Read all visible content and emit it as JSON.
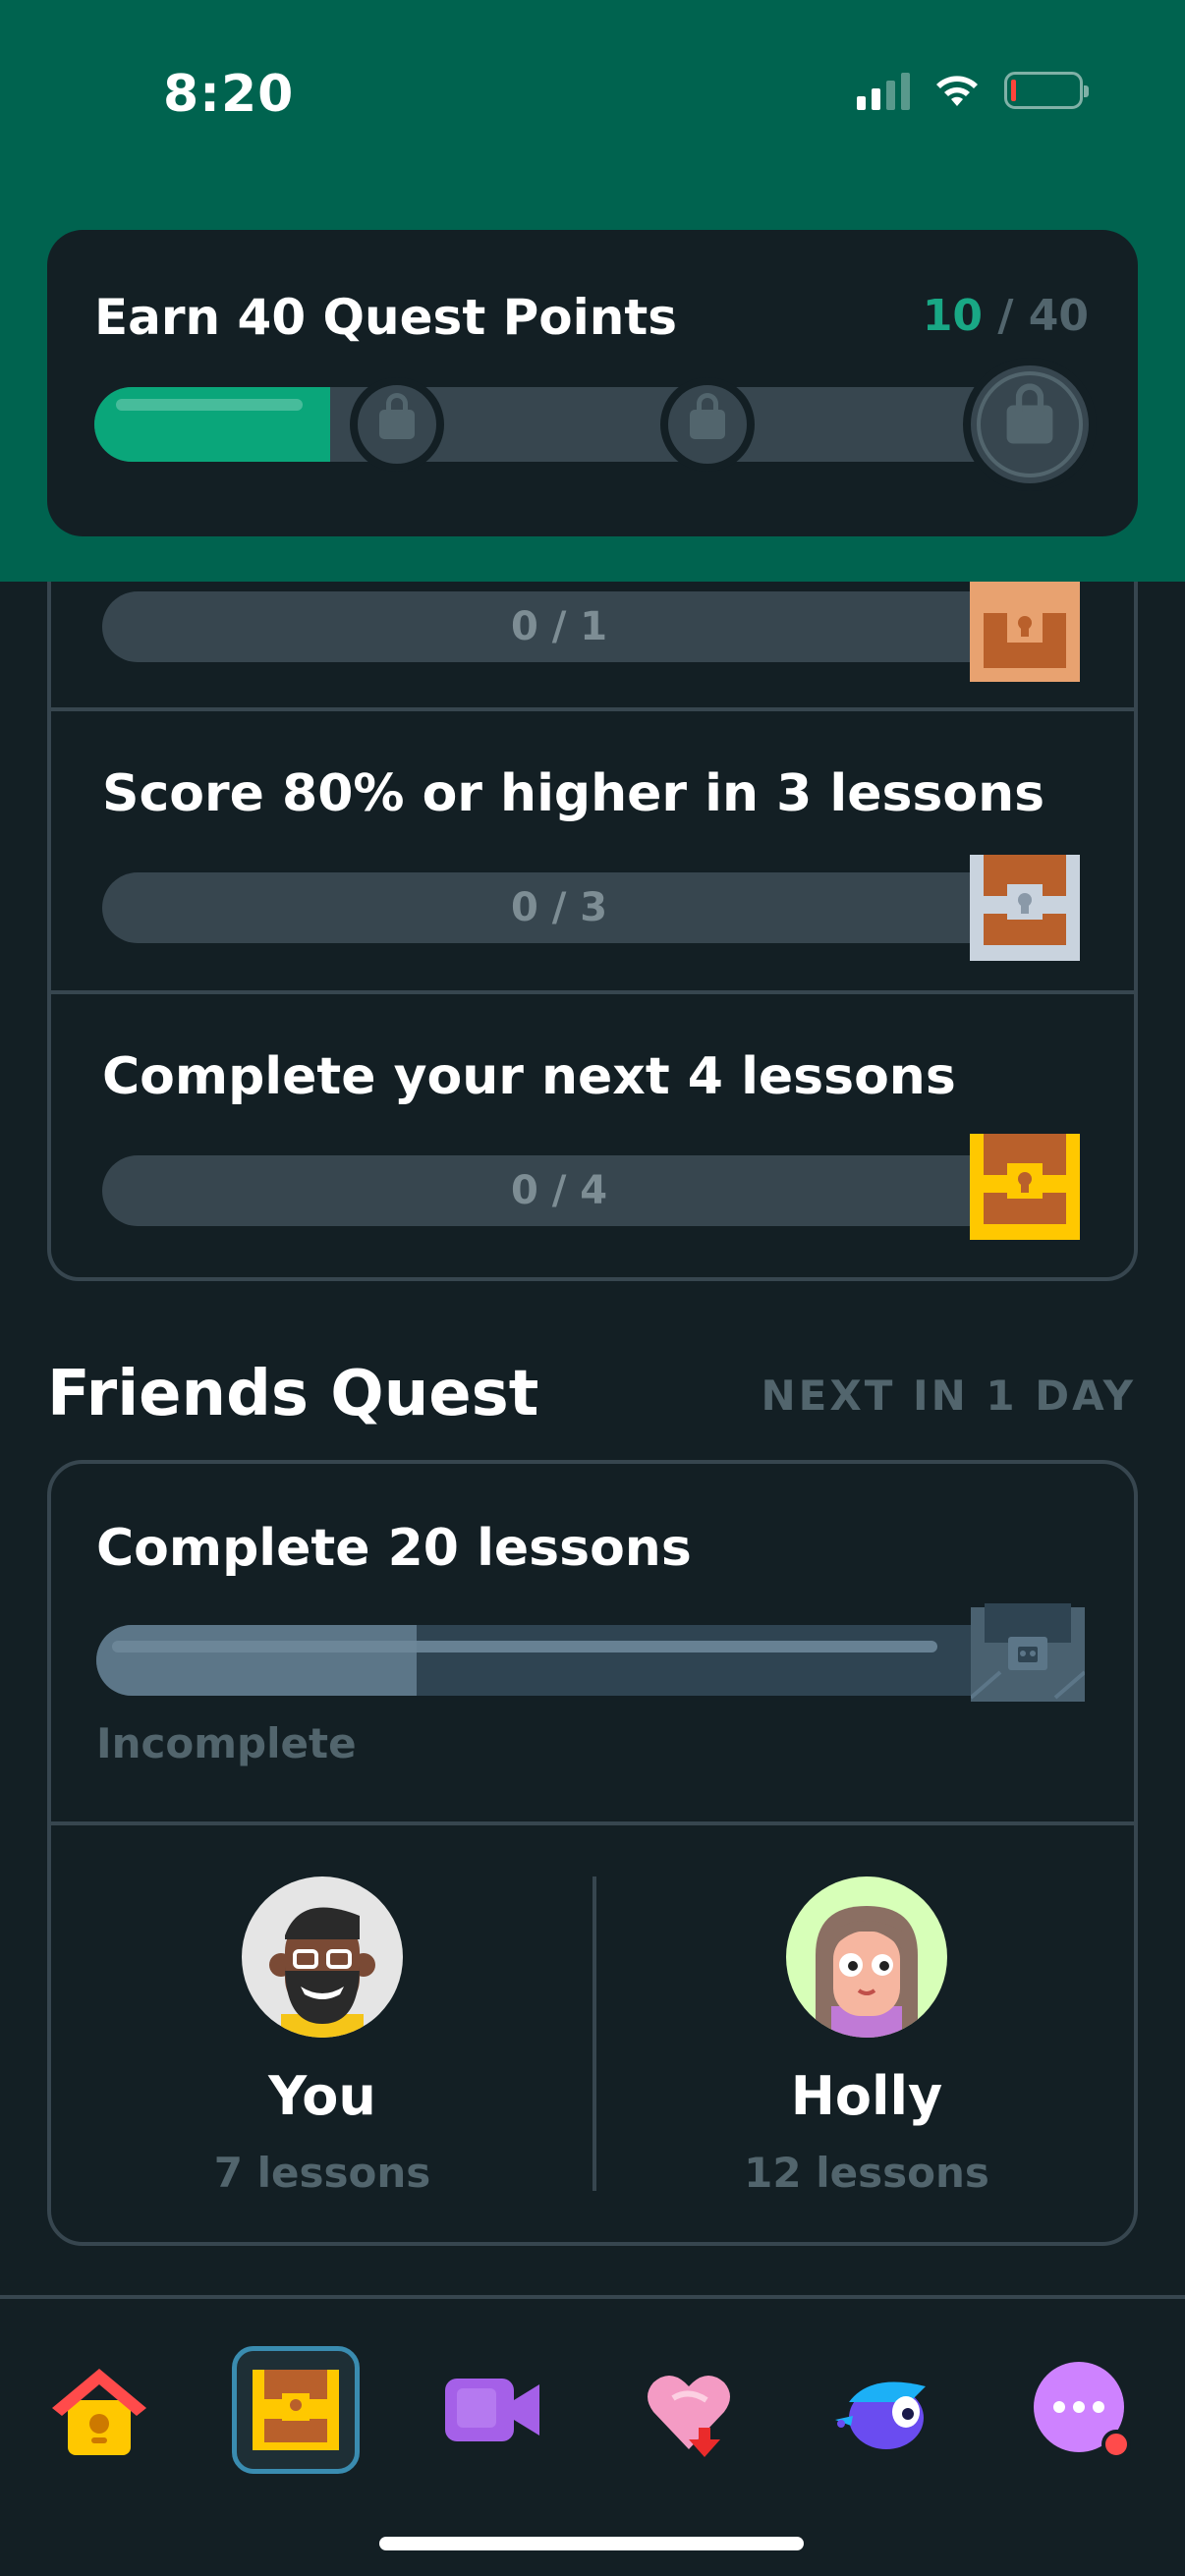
{
  "status_bar": {
    "time": "8:20"
  },
  "quest_points": {
    "title": "Earn 40 Quest Points",
    "current": "10",
    "total": "/ 40",
    "progress_fraction": 0.25
  },
  "daily_quests": [
    {
      "label": "",
      "progress": "0 / 1",
      "chest": "bronze"
    },
    {
      "label": "Score 80% or higher in 3 lessons",
      "progress": "0 / 3",
      "chest": "silver"
    },
    {
      "label": "Complete your next 4 lessons",
      "progress": "0 / 4",
      "chest": "gold"
    }
  ],
  "friends_quest": {
    "title": "Friends Quest",
    "next_label": "NEXT IN 1 DAY",
    "task": "Complete 20 lessons",
    "status": "Incomplete",
    "progress_fraction": 0.35,
    "friends": [
      {
        "name": "You",
        "lessons": "7 lessons",
        "avatar": "bearded-man-avatar"
      },
      {
        "name": "Holly",
        "lessons": "12 lessons",
        "avatar": "girl-glasses-avatar"
      }
    ]
  },
  "bottom_nav": {
    "items": [
      "home-icon",
      "quests-chest-icon",
      "video-call-icon",
      "hearts-icon",
      "avatar-bird-icon",
      "more-icon"
    ],
    "active": "quests-chest-icon"
  },
  "colors": {
    "header_green": "#00634f",
    "background": "#131f24",
    "progress_green": "#0aa67a",
    "track": "#37464f"
  }
}
